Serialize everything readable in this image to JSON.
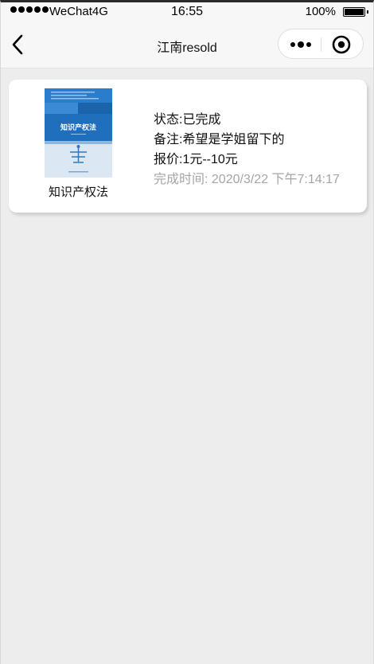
{
  "status_bar": {
    "carrier": "WeChat4G",
    "time": "16:55",
    "battery": "100%"
  },
  "nav": {
    "title": "江南resold"
  },
  "order": {
    "book": {
      "name": "知识产权法",
      "cover_title": "知识产权法"
    },
    "status_label": "状态:",
    "status_value": "已完成",
    "note_label": "备注:",
    "note_value": "希望是学姐留下的",
    "price_label": "报价:",
    "price_value": "1元--10元",
    "complete_label": "完成时间:",
    "complete_value": "2020/3/22 下午7:14:17"
  },
  "colors": {
    "page_bg": "#ededed",
    "card_bg": "#ffffff",
    "muted_text": "#a5a5a5",
    "cover_blue": "#1f6fbd"
  }
}
